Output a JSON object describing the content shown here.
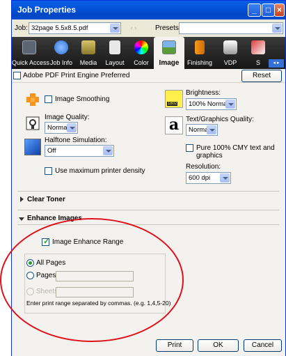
{
  "window": {
    "title": "Job Properties"
  },
  "job": {
    "label": "Job:",
    "value": "32page 5.5x8.5.pdf",
    "nav": "‹ ›",
    "presets_label": "Presets:",
    "presets_value": ""
  },
  "tabs": [
    {
      "label": "Quick Access",
      "icon": "quick-access-icon"
    },
    {
      "label": "Job Info",
      "icon": "info-icon"
    },
    {
      "label": "Media",
      "icon": "media-icon"
    },
    {
      "label": "Layout",
      "icon": "layout-icon"
    },
    {
      "label": "Color",
      "icon": "color-wheel-icon"
    },
    {
      "label": "Image",
      "icon": "image-icon",
      "active": true
    },
    {
      "label": "Finishing",
      "icon": "finishing-icon"
    },
    {
      "label": "VDP",
      "icon": "vdp-icon"
    },
    {
      "label": "S",
      "icon": "stamp-icon"
    }
  ],
  "tab_scroll": "◂ ▸",
  "pdf_engine": {
    "label": "Adobe PDF Print Engine Preferred",
    "checked": false
  },
  "reset_label": "Reset",
  "image": {
    "smoothing_label": "Image Smoothing",
    "quality_label": "Image Quality:",
    "quality_value": "Normal",
    "halftone_label": "Halftone Simulation:",
    "halftone_value": "Off",
    "max_density_label": "Use maximum printer density",
    "brightness_label": "Brightness:",
    "brightness_value": "100% Normal",
    "brightness_badge": "1802",
    "textgfx_label": "Text/Graphics Quality:",
    "textgfx_value": "Normal",
    "text_icon_glyph": "a",
    "pure_cmy_label": "Pure 100% CMY text and graphics",
    "resolution_label": "Resolution:",
    "resolution_value": "600 dpi"
  },
  "clear_toner": {
    "label": "Clear Toner"
  },
  "enhance": {
    "label": "Enhance Images",
    "range_label": "Image Enhance Range",
    "range_checked": true,
    "all_pages_label": "All Pages",
    "pages_label": "Pages",
    "sheets_label": "Sheets",
    "hint": "Enter print range separated by commas. (e.g. 1,4,5-20)"
  },
  "buttons": {
    "print": "Print",
    "ok": "OK",
    "cancel": "Cancel"
  },
  "colors": {
    "titlebar": "#0354d6",
    "tabbar": "#1f1f1f",
    "annotation": "#e0101a"
  }
}
